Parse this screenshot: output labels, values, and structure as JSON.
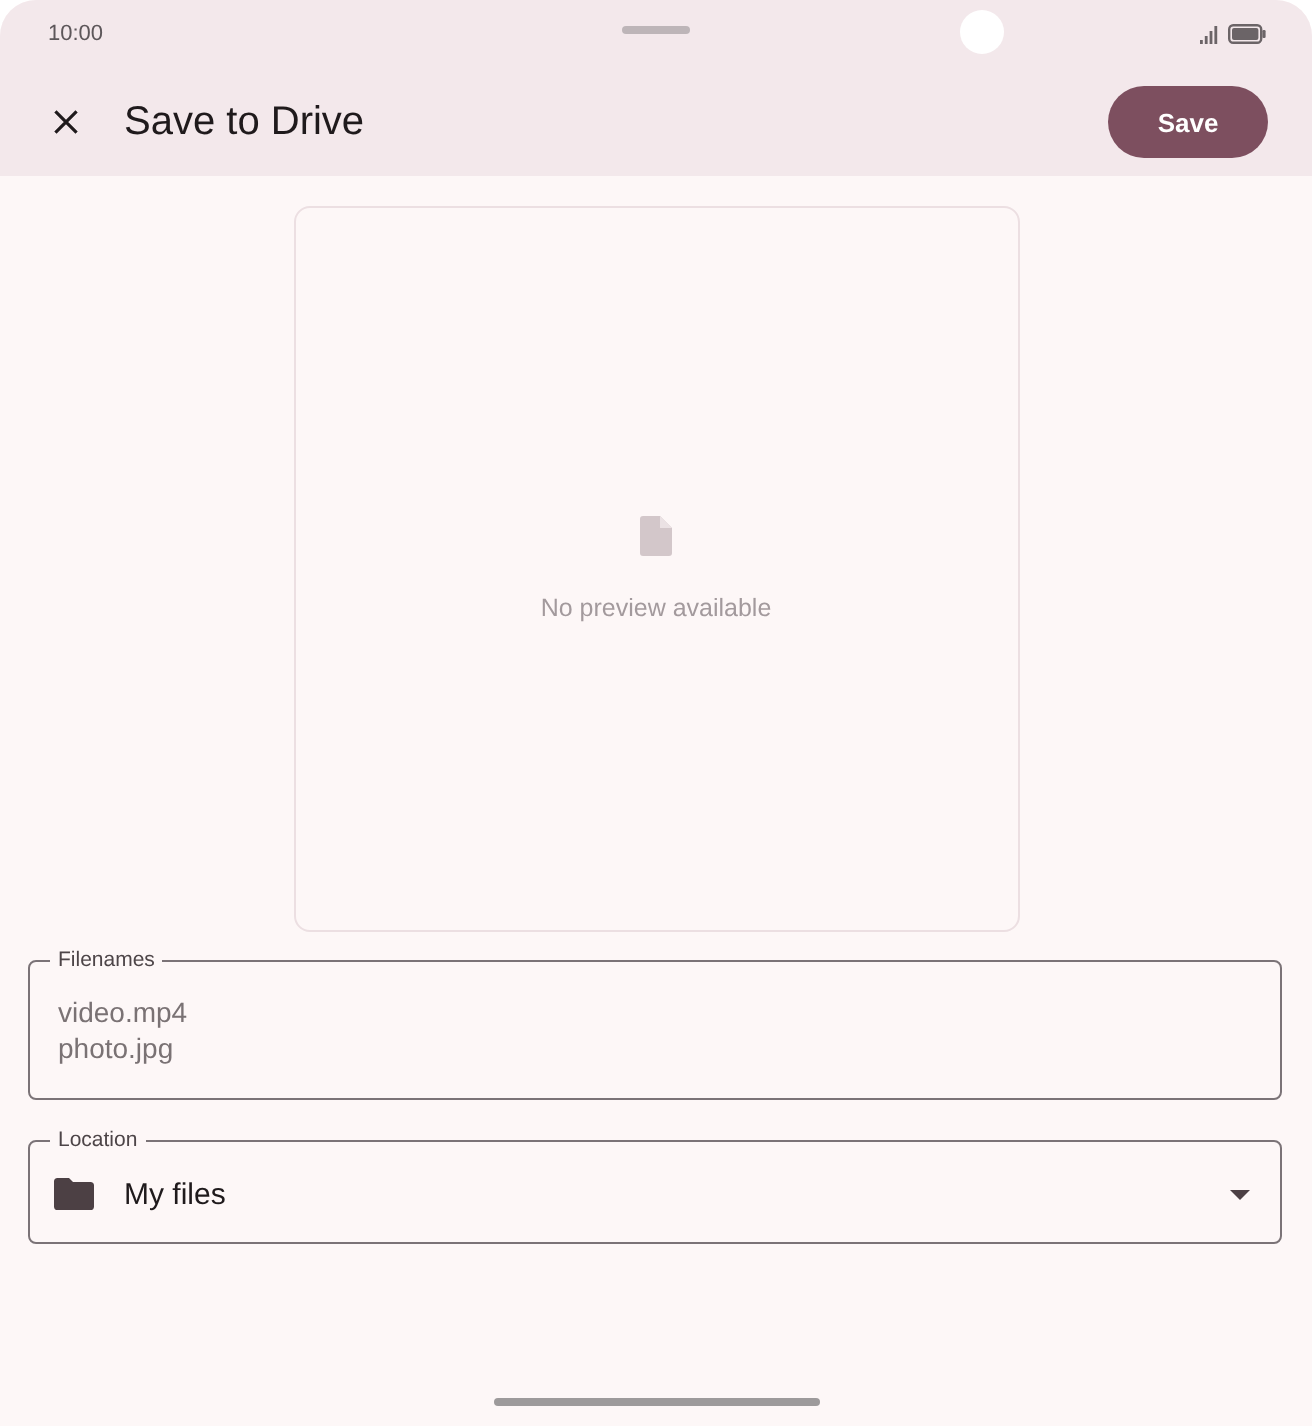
{
  "status_bar": {
    "time": "10:00"
  },
  "app_bar": {
    "title": "Save to Drive",
    "save_button": "Save"
  },
  "preview": {
    "message": "No preview available"
  },
  "filenames": {
    "label": "Filenames",
    "values": [
      "video.mp4",
      "photo.jpg"
    ]
  },
  "location": {
    "label": "Location",
    "value": "My files"
  }
}
